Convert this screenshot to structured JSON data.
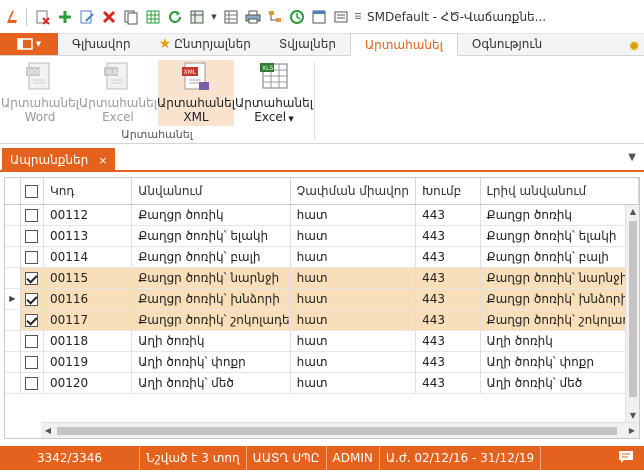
{
  "window": {
    "title": "SMDefault - ՀԾ-Վաճառքնե..."
  },
  "ribbon_tabs": [
    {
      "label": "Գլխավոր",
      "active": false
    },
    {
      "label": "Ընտրյալներ",
      "active": false,
      "icon": "star-icon"
    },
    {
      "label": "Տվյալներ",
      "active": false
    },
    {
      "label": "Արտահանել",
      "active": true
    },
    {
      "label": "Օգնություն",
      "active": false
    }
  ],
  "ribbon": {
    "buttons": [
      {
        "line1": "Արտահանել",
        "line2": "Word",
        "disabled": true,
        "icon": "export-word-icon"
      },
      {
        "line1": "Արտահանել",
        "line2": "Excel",
        "disabled": true,
        "icon": "export-excel-icon"
      },
      {
        "line1": "Արտահանել",
        "line2": "XML",
        "disabled": false,
        "icon": "export-xml-icon"
      },
      {
        "line1": "Արտահանել",
        "line2": "Excel",
        "disabled": false,
        "icon": "export-excel-table-icon",
        "dropdown": true
      }
    ],
    "group_label": "Արտահանել"
  },
  "document_tab": {
    "label": "Ապրանքներ",
    "close": "×"
  },
  "grid": {
    "columns": [
      "Կոդ",
      "Անվանում",
      "Չափման միավոր",
      "Խումբ",
      "Լրիվ անվանում"
    ],
    "rows": [
      {
        "checked": false,
        "selected": false,
        "current": false,
        "code": "00112",
        "name": "Քաղցր ծոռիկ",
        "unit": "հատ",
        "group": "443",
        "full": "Քաղցր ծոռիկ"
      },
      {
        "checked": false,
        "selected": false,
        "current": false,
        "code": "00113",
        "name": "Քաղցր ծոռիկ՝ ելակի",
        "unit": "հատ",
        "group": "443",
        "full": "Քաղցր ծոռիկ՝ ելակի"
      },
      {
        "checked": false,
        "selected": false,
        "current": false,
        "code": "00114",
        "name": "Քաղցր ծոռիկ՝ բալի",
        "unit": "հատ",
        "group": "443",
        "full": "Քաղցր ծոռիկ՝ բալի"
      },
      {
        "checked": true,
        "selected": true,
        "current": false,
        "code": "00115",
        "name": "Քաղցր ծոռիկ՝ նարնջի",
        "unit": "հատ",
        "group": "443",
        "full": "Քաղցր ծոռիկ՝ նարնջի"
      },
      {
        "checked": true,
        "selected": true,
        "current": true,
        "code": "00116",
        "name": "Քաղցր ծոռիկ՝ խնձորի",
        "unit": "հատ",
        "group": "443",
        "full": "Քաղցր ծոռիկ՝ խնձորի"
      },
      {
        "checked": true,
        "selected": true,
        "current": false,
        "code": "00117",
        "name": "Քաղցր ծոռիկ՝ շոկոլադե",
        "unit": "հատ",
        "group": "443",
        "full": "Քաղցր ծոռիկ՝ շոկոլադե"
      },
      {
        "checked": false,
        "selected": false,
        "current": false,
        "code": "00118",
        "name": "Աղի ծոռիկ",
        "unit": "հատ",
        "group": "443",
        "full": "Աղի ծոռիկ"
      },
      {
        "checked": false,
        "selected": false,
        "current": false,
        "code": "00119",
        "name": "Աղի ծոռիկ՝ փոքր",
        "unit": "հատ",
        "group": "443",
        "full": "Աղի ծոռիկ՝ փոքր"
      },
      {
        "checked": false,
        "selected": false,
        "current": false,
        "code": "00120",
        "name": "Աղի ծոռիկ՝ մեծ",
        "unit": "հատ",
        "group": "443",
        "full": "Աղի ծոռիկ՝ մեծ"
      }
    ]
  },
  "status": {
    "count": "3342/3346",
    "selected": "Նշված է 3 տող",
    "org": "ԱԱՏՂ ՍՊԸ",
    "user": "ADMIN",
    "period": "Ա.ժ. 02/12/16 - 31/12/19"
  },
  "colors": {
    "accent": "#e4621e",
    "selection": "#f8dfb9"
  }
}
